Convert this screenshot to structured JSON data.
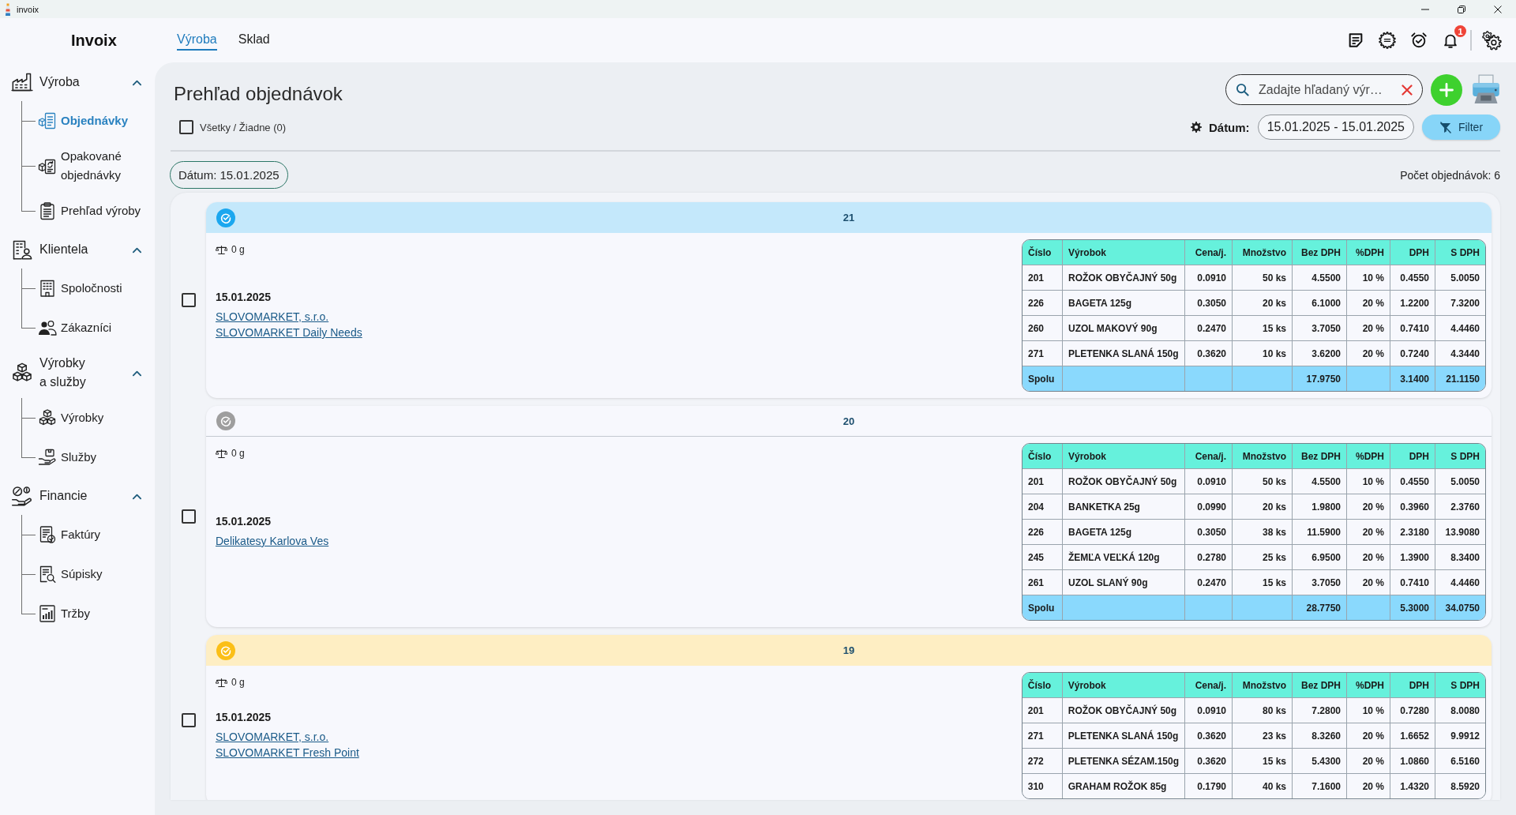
{
  "window": {
    "title": "invoix"
  },
  "header": {
    "logo": "Invoix",
    "tabs": [
      {
        "label": "Výroba",
        "selected": true
      },
      {
        "label": "Sklad",
        "selected": false
      }
    ],
    "notification_count": "1"
  },
  "sidebar": {
    "sections": [
      {
        "label": "Výroba",
        "expanded": true,
        "children": [
          {
            "label": "Objednávky",
            "selected": true
          },
          {
            "label": "Opakované objednávky",
            "selected": false
          },
          {
            "label": "Prehľad výroby",
            "selected": false
          }
        ]
      },
      {
        "label": "Klientela",
        "expanded": true,
        "children": [
          {
            "label": "Spoločnosti",
            "selected": false
          },
          {
            "label": "Zákazníci",
            "selected": false
          }
        ]
      },
      {
        "label": "Výrobky a služby",
        "expanded": true,
        "children": [
          {
            "label": "Výrobky",
            "selected": false
          },
          {
            "label": "Služby",
            "selected": false
          }
        ]
      },
      {
        "label": "Financie",
        "expanded": true,
        "children": [
          {
            "label": "Faktúry",
            "selected": false
          },
          {
            "label": "Súpisky",
            "selected": false
          },
          {
            "label": "Tržby",
            "selected": false
          }
        ]
      }
    ]
  },
  "page": {
    "title": "Prehľad objednávok",
    "select_all": {
      "label": "Všetky / Žiadne (0)",
      "checked": false
    },
    "search": {
      "placeholder": "Zadajte hľadaný výr…"
    },
    "date_filter": {
      "label": "Dátum:",
      "value": "15.01.2025 - 15.01.2025"
    },
    "filter_button": "Filter",
    "group_label": "Dátum: 15.01.2025",
    "order_count": "Počet objednávok: 6"
  },
  "orders": [
    {
      "number": "21",
      "color": "#1ba7ef",
      "checked": false,
      "weight": "0 g",
      "date": "15.01.2025",
      "customers": [
        "SLOVOMARKET, s.r.o.",
        "SLOVOMARKET Daily Needs"
      ],
      "table": {
        "columns": [
          "Číslo",
          "Výrobok",
          "Cena/j.",
          "Množstvo",
          "Bez DPH",
          "%DPH",
          "DPH",
          "S DPH"
        ],
        "rows": [
          [
            "201",
            "ROŽOK OBYČAJNÝ 50g",
            "0.0910",
            "50 ks",
            "4.5500",
            "10 %",
            "0.4550",
            "5.0050"
          ],
          [
            "226",
            "BAGETA 125g",
            "0.3050",
            "20 ks",
            "6.1000",
            "20 %",
            "1.2200",
            "7.3200"
          ],
          [
            "260",
            "UZOL MAKOVÝ 90g",
            "0.2470",
            "15 ks",
            "3.7050",
            "20 %",
            "0.7410",
            "4.4460"
          ],
          [
            "271",
            "PLETENKA SLANÁ 150g",
            "0.3620",
            "10 ks",
            "3.6200",
            "20 %",
            "0.7240",
            "4.3440"
          ]
        ],
        "total": {
          "label": "Spolu",
          "net": "17.9750",
          "vat": "3.1400",
          "gross": "21.1150"
        }
      }
    },
    {
      "number": "20",
      "color": "#9e9e9e",
      "checked": false,
      "weight": "0 g",
      "date": "15.01.2025",
      "customers": [
        "Delikatesy Karlova Ves"
      ],
      "table": {
        "columns": [
          "Číslo",
          "Výrobok",
          "Cena/j.",
          "Množstvo",
          "Bez DPH",
          "%DPH",
          "DPH",
          "S DPH"
        ],
        "rows": [
          [
            "201",
            "ROŽOK OBYČAJNÝ 50g",
            "0.0910",
            "50 ks",
            "4.5500",
            "10 %",
            "0.4550",
            "5.0050"
          ],
          [
            "204",
            "BANKETKA 25g",
            "0.0990",
            "20 ks",
            "1.9800",
            "20 %",
            "0.3960",
            "2.3760"
          ],
          [
            "226",
            "BAGETA 125g",
            "0.3050",
            "38 ks",
            "11.5900",
            "20 %",
            "2.3180",
            "13.9080"
          ],
          [
            "245",
            "ŽEMĽA VEĽKÁ 120g",
            "0.2780",
            "25 ks",
            "6.9500",
            "20 %",
            "1.3900",
            "8.3400"
          ],
          [
            "261",
            "UZOL SLANÝ 90g",
            "0.2470",
            "15 ks",
            "3.7050",
            "20 %",
            "0.7410",
            "4.4460"
          ]
        ],
        "total": {
          "label": "Spolu",
          "net": "28.7750",
          "vat": "5.3000",
          "gross": "34.0750"
        }
      }
    },
    {
      "number": "19",
      "color": "#fbbf17",
      "checked": false,
      "weight": "0 g",
      "date": "15.01.2025",
      "customers": [
        "SLOVOMARKET, s.r.o.",
        "SLOVOMARKET Fresh Point"
      ],
      "table": {
        "columns": [
          "Číslo",
          "Výrobok",
          "Cena/j.",
          "Množstvo",
          "Bez DPH",
          "%DPH",
          "DPH",
          "S DPH"
        ],
        "rows": [
          [
            "201",
            "ROŽOK OBYČAJNÝ 50g",
            "0.0910",
            "80 ks",
            "7.2800",
            "10 %",
            "0.7280",
            "8.0080"
          ],
          [
            "271",
            "PLETENKA SLANÁ 150g",
            "0.3620",
            "23 ks",
            "8.3260",
            "20 %",
            "1.6652",
            "9.9912"
          ],
          [
            "272",
            "PLETENKA SÉZAM.150g",
            "0.3620",
            "15 ks",
            "5.4300",
            "20 %",
            "1.0860",
            "6.5160"
          ],
          [
            "310",
            "GRAHAM ROŽOK 85g",
            "0.1790",
            "40 ks",
            "7.1600",
            "20 %",
            "1.4320",
            "8.5920"
          ]
        ]
      }
    }
  ]
}
